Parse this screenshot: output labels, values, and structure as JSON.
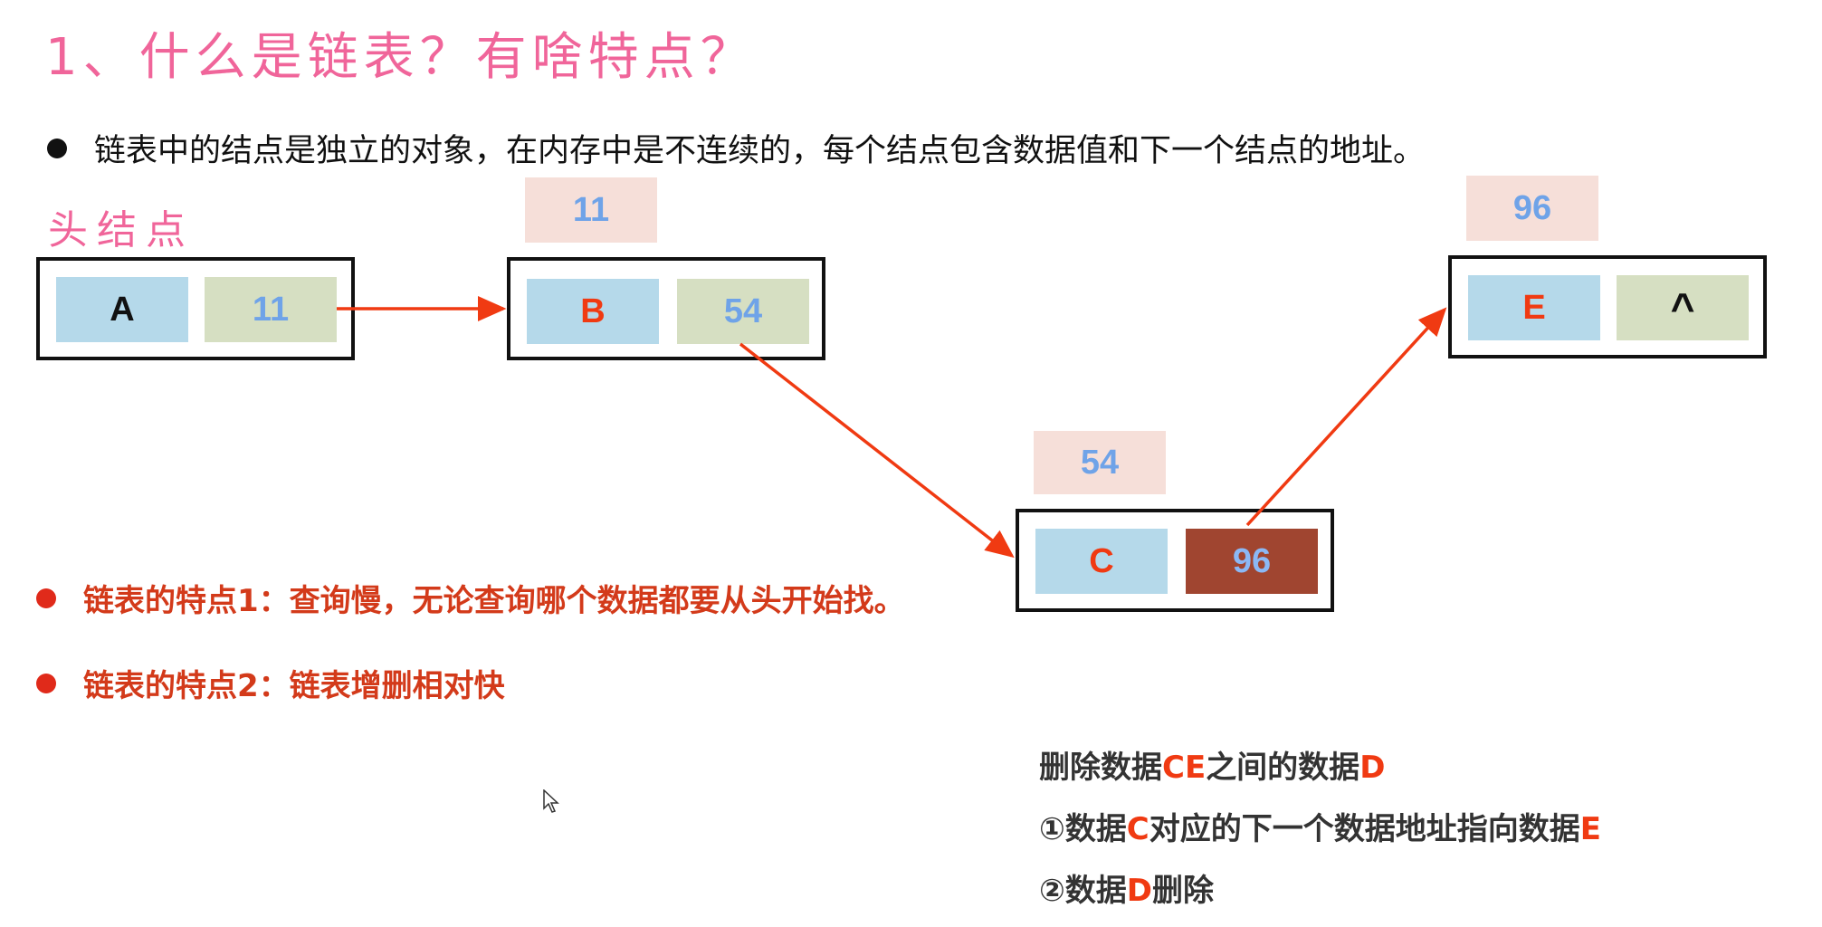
{
  "title": "1、什么是链表？有啥特点？",
  "intro": "链表中的结点是独立的对象，在内存中是不连续的，每个结点包含数据值和下一个结点的地址。",
  "head_label": "头结点",
  "nodes": [
    {
      "data": "A",
      "next": "11",
      "address": ""
    },
    {
      "data": "B",
      "next": "54",
      "address": "11"
    },
    {
      "data": "C",
      "next": "96",
      "address": "54"
    },
    {
      "data": "E",
      "next": "^",
      "address": "96"
    }
  ],
  "features": [
    "链表的特点1：查询慢，无论查询哪个数据都要从头开始找。",
    "链表的特点2：链表增删相对快"
  ],
  "notes": {
    "line1": {
      "a": "删除数据",
      "b": "CE",
      "c": "之间的数据",
      "d": "D"
    },
    "line2": {
      "a": "①数据",
      "b": "C",
      "c": "对应的下一个数据地址指向数据",
      "d": "E"
    },
    "line3": {
      "a": "②数据",
      "b": "D",
      "c": "删除"
    }
  },
  "colors": {
    "title": "#f0659a",
    "arrow": "#f03a12",
    "data_cell": "#b5d9ea",
    "next_cell": "#d6dfc2",
    "address_box": "#f6dfd9",
    "highlight_cell": "#a04530"
  }
}
